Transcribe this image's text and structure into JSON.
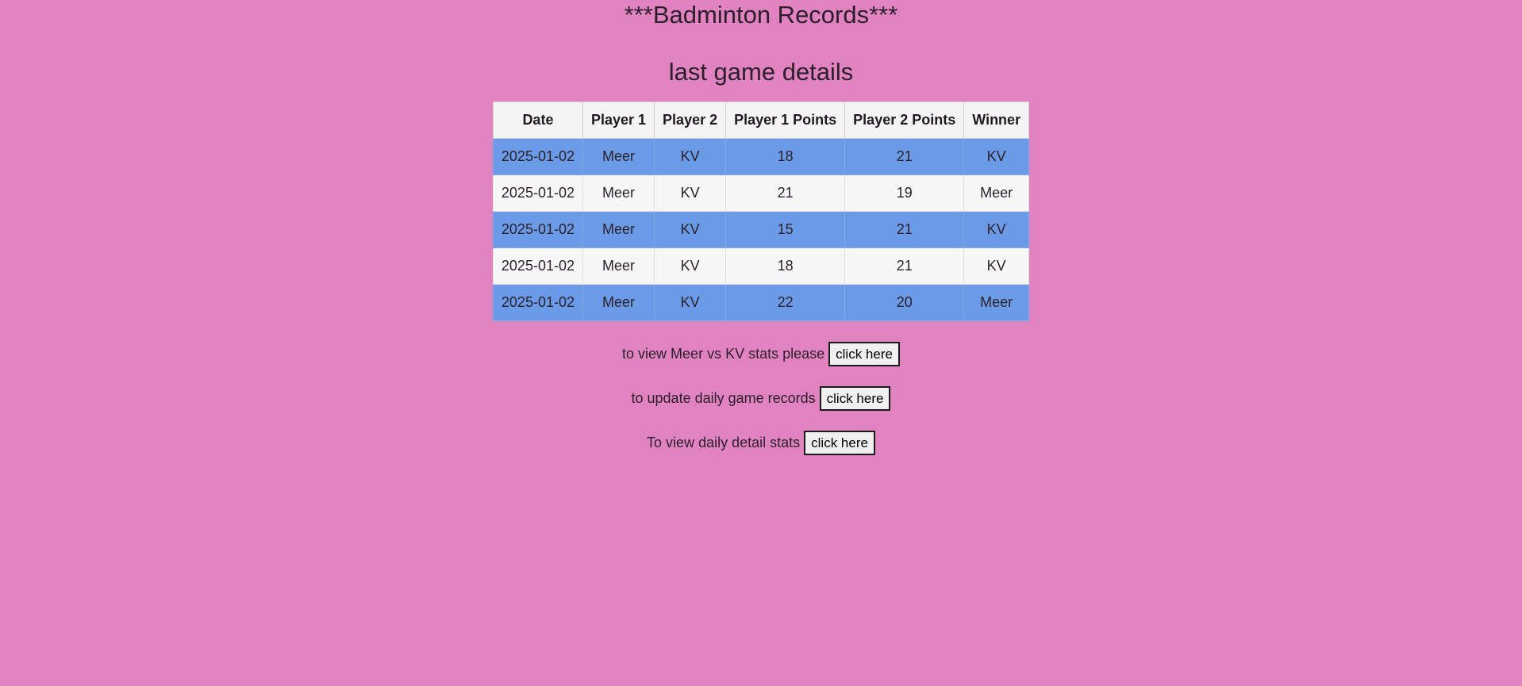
{
  "header": {
    "title": "***Badminton Records***",
    "subtitle": "last game details"
  },
  "table": {
    "columns": [
      "Date",
      "Player 1",
      "Player 2",
      "Player 1 Points",
      "Player 2 Points",
      "Winner"
    ],
    "rows": [
      {
        "date": "2025-01-02",
        "player1": "Meer",
        "player2": "KV",
        "p1_points": "18",
        "p2_points": "21",
        "winner": "KV"
      },
      {
        "date": "2025-01-02",
        "player1": "Meer",
        "player2": "KV",
        "p1_points": "21",
        "p2_points": "19",
        "winner": "Meer"
      },
      {
        "date": "2025-01-02",
        "player1": "Meer",
        "player2": "KV",
        "p1_points": "15",
        "p2_points": "21",
        "winner": "KV"
      },
      {
        "date": "2025-01-02",
        "player1": "Meer",
        "player2": "KV",
        "p1_points": "18",
        "p2_points": "21",
        "winner": "KV"
      },
      {
        "date": "2025-01-02",
        "player1": "Meer",
        "player2": "KV",
        "p1_points": "22",
        "p2_points": "20",
        "winner": "Meer"
      }
    ],
    "row_colors": {
      "highlight": "#6b9be6",
      "plain": "#f7f7f7"
    }
  },
  "actions": [
    {
      "text": "to view Meer vs KV stats please",
      "button_label": "click here"
    },
    {
      "text": "to update daily game records",
      "button_label": "click here"
    },
    {
      "text": "To view daily detail stats",
      "button_label": "click here"
    }
  ],
  "colors": {
    "page_background": "#e083c0"
  }
}
